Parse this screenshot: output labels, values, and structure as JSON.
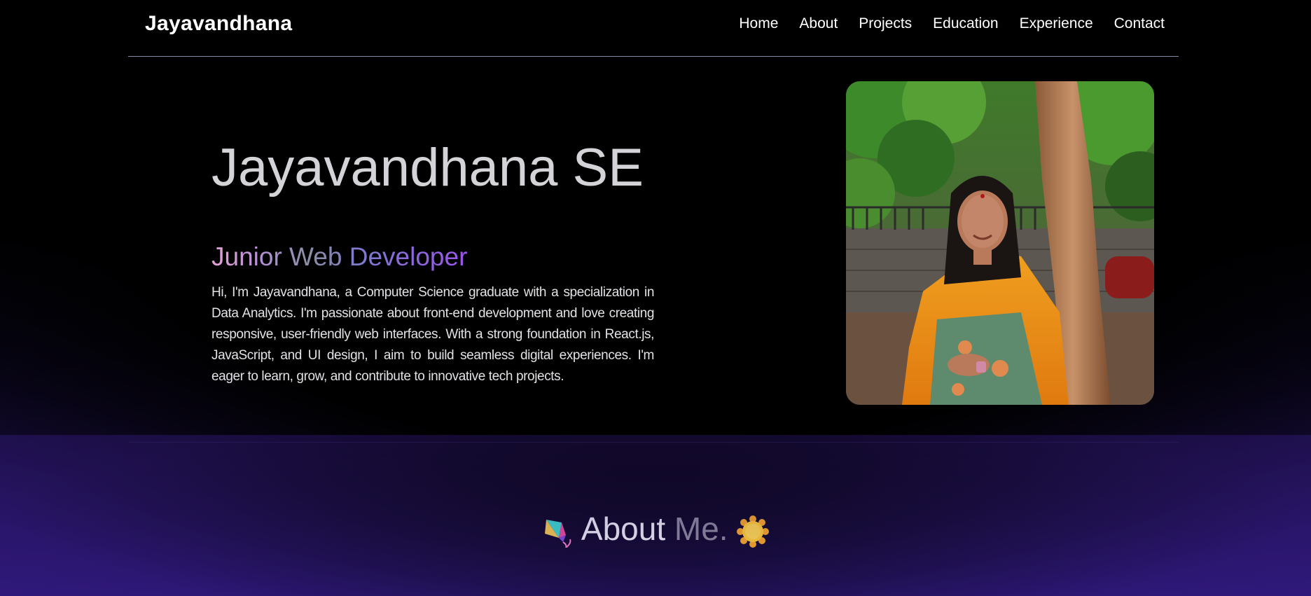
{
  "nav": {
    "brand": "Jayavandhana",
    "links": [
      {
        "label": "Home"
      },
      {
        "label": "About"
      },
      {
        "label": "Projects"
      },
      {
        "label": "Education"
      },
      {
        "label": "Experience"
      },
      {
        "label": "Contact"
      }
    ]
  },
  "hero": {
    "name": "Jayavandhana SE",
    "role": "Junior Web Developer",
    "bio": "Hi, I'm Jayavandhana, a Computer Science graduate with a specialization in Data Analytics. I'm passionate about front-end development and love creating responsive, user-friendly web interfaces. With a strong foundation in React.js, JavaScript, and UI design, I aim to build seamless digital experiences. I'm eager to learn, grow, and contribute to innovative tech projects.",
    "photo_icon": "profile-photo"
  },
  "about": {
    "title_word": "About",
    "title_me": "Me.",
    "left_icon": "kite-icon",
    "right_icon": "sun-icon"
  },
  "colors": {
    "background": "#000000",
    "bottom_glow": "#2a1670",
    "text_primary": "#ffffff",
    "text_muted": "#d4d4d8",
    "role_gradient_start": "#e7a2d6",
    "role_gradient_end": "#9a55ea"
  }
}
